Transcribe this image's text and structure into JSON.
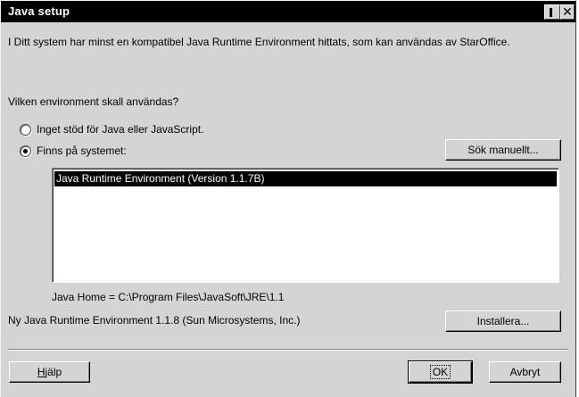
{
  "window": {
    "title": "Java setup",
    "minimize_symbol": "",
    "close_symbol": "✕"
  },
  "info": {
    "found_text": "I Ditt system har minst en kompatibel Java Runtime Environment hittats, som kan användas av StarOffice."
  },
  "question": {
    "text": "Vilken environment skall användas?"
  },
  "options": {
    "none_label": "Inget stöd för Java eller JavaScript.",
    "system_label": "Finns på systemet:",
    "selected": "system"
  },
  "buttons": {
    "search_manual": "Sök manuellt...",
    "install": "Installera...",
    "help_accel": "H",
    "help_rest": "jälp",
    "ok": "OK",
    "cancel": "Avbryt"
  },
  "environments": {
    "items": [
      "Java Runtime Environment (Version 1.1.7B)"
    ],
    "selected_index": 0
  },
  "java_home": {
    "text": "Java Home = C:\\Program Files\\JavaSoft\\JRE\\1.1"
  },
  "new_jre": {
    "text": "Ny Java Runtime Environment 1.1.8 (Sun Microsystems, Inc.)"
  }
}
